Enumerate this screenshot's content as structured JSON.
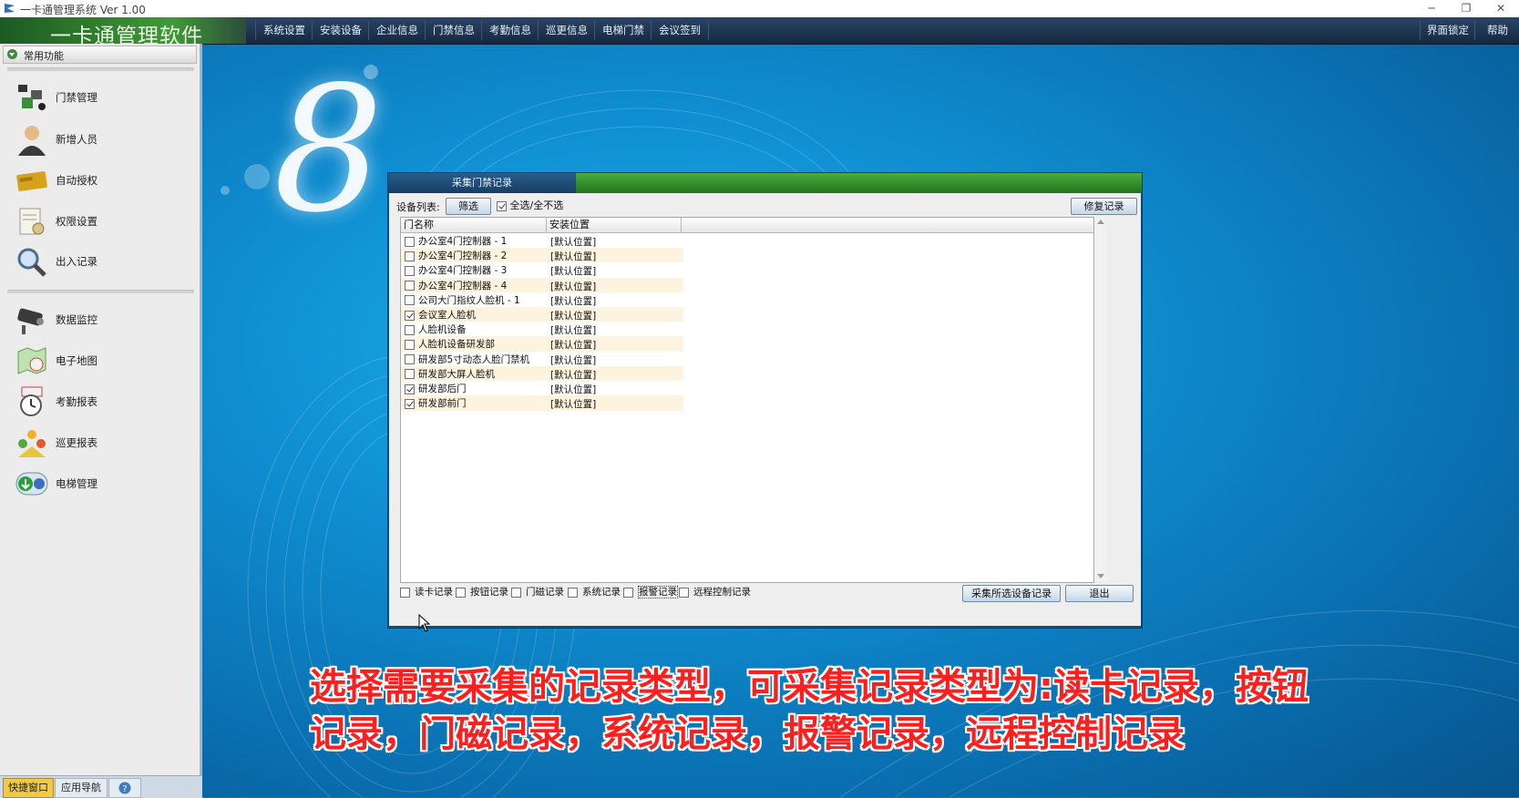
{
  "window": {
    "title": "一卡通管理系统  Ver 1.00",
    "brand": "一卡通管理软件",
    "controls": [
      "─",
      "❐",
      "✕"
    ]
  },
  "menu": {
    "items": [
      "系统设置",
      "安装设备",
      "企业信息",
      "门禁信息",
      "考勤信息",
      "巡更信息",
      "电梯门禁",
      "会议签到"
    ],
    "right_items": [
      "界面锁定",
      "帮助"
    ]
  },
  "sidebar": {
    "header": "常用功能",
    "items": [
      {
        "label": "门禁管理",
        "icon": "access-control-icon"
      },
      {
        "label": "新增人员",
        "icon": "person-icon"
      },
      {
        "label": "自动授权",
        "icon": "card-icon"
      },
      {
        "label": "权限设置",
        "icon": "permission-document-icon"
      },
      {
        "label": "出入记录",
        "icon": "magnifier-icon"
      },
      {
        "label": "数据监控",
        "icon": "camera-icon"
      },
      {
        "label": "电子地图",
        "icon": "map-icon"
      },
      {
        "label": "考勤报表",
        "icon": "alarm-clock-icon"
      },
      {
        "label": "巡更报表",
        "icon": "patrol-people-icon"
      },
      {
        "label": "电梯管理",
        "icon": "elevator-arrows-icon"
      }
    ],
    "tabs": [
      "快捷窗口",
      "应用导航"
    ]
  },
  "dialog": {
    "title": "采集门禁记录",
    "device_list_label": "设备列表:",
    "filter_button": "筛选",
    "select_all_label": "全选/全不选",
    "select_all_checked": true,
    "repair_button": "修复记录",
    "columns": [
      "门名称",
      "安装位置"
    ],
    "rows": [
      {
        "name": "办公室4门控制器 - 1",
        "location": "[默认位置]",
        "checked": false
      },
      {
        "name": "办公室4门控制器 - 2",
        "location": "[默认位置]",
        "checked": false
      },
      {
        "name": "办公室4门控制器 - 3",
        "location": "[默认位置]",
        "checked": false
      },
      {
        "name": "办公室4门控制器 - 4",
        "location": "[默认位置]",
        "checked": false
      },
      {
        "name": "公司大门指纹人脸机 - 1",
        "location": "[默认位置]",
        "checked": false
      },
      {
        "name": "会议室人脸机",
        "location": "[默认位置]",
        "checked": true
      },
      {
        "name": "人脸机设备",
        "location": "[默认位置]",
        "checked": false
      },
      {
        "name": "人脸机设备研发部",
        "location": "[默认位置]",
        "checked": false
      },
      {
        "name": "研发部5寸动态人脸门禁机",
        "location": "[默认位置]",
        "checked": false
      },
      {
        "name": "研发部大屏人脸机",
        "location": "[默认位置]",
        "checked": false
      },
      {
        "name": "研发部后门",
        "location": "[默认位置]",
        "checked": true
      },
      {
        "name": "研发部前门",
        "location": "[默认位置]",
        "checked": true
      }
    ],
    "record_types": [
      {
        "label": "读卡记录",
        "checked": false
      },
      {
        "label": "按钮记录",
        "checked": false
      },
      {
        "label": "门磁记录",
        "checked": false
      },
      {
        "label": "系统记录",
        "checked": false
      },
      {
        "label": "报警记录",
        "checked": false
      },
      {
        "label": "远程控制记录",
        "checked": false
      }
    ],
    "collect_button": "采集所选设备记录",
    "exit_button": "退出"
  },
  "caption": {
    "line1": "选择需要采集的记录类型，可采集记录类型为:读卡记录，按钮",
    "line2": "记录，门磁记录，系统记录，报警记录，远程控制记录"
  },
  "colors": {
    "desktop_blue": "#0f8fd2",
    "caption_red": "#ff1e1e",
    "dialog_green": "#22731e",
    "row_alt": "#fdf3df"
  }
}
